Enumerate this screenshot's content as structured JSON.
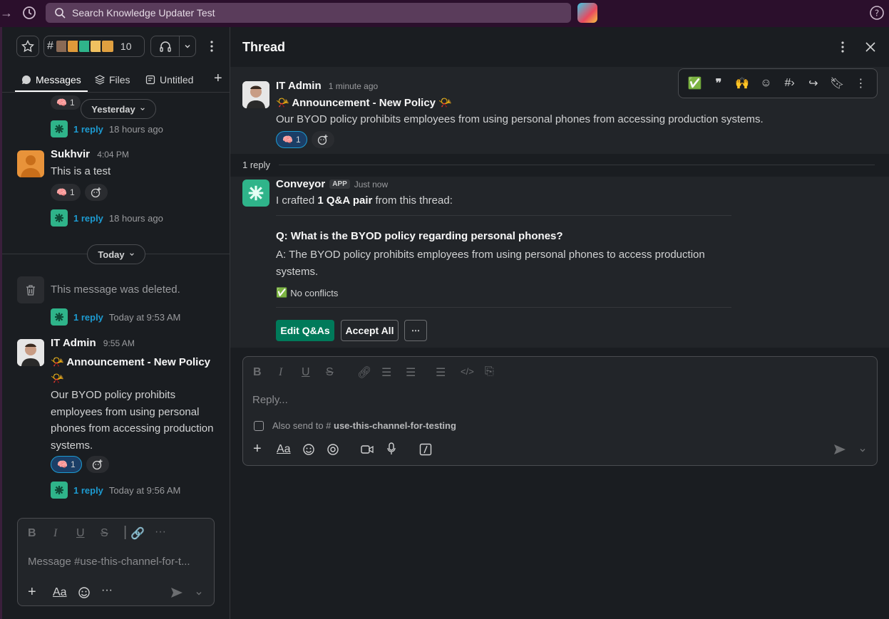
{
  "topbar": {
    "search_placeholder": "Search Knowledge Updater Test"
  },
  "channel_header": {
    "member_count": "10"
  },
  "tabs": [
    {
      "label": "Messages"
    },
    {
      "label": "Files"
    },
    {
      "label": "Untitled"
    }
  ],
  "left_feed": {
    "partial_reaction_count": "1",
    "day1": "Yesterday",
    "reply1": {
      "link": "1 reply",
      "when": "18 hours ago"
    },
    "sukhvir": {
      "name": "Sukhvir",
      "time": "4:04 PM",
      "text": "This is a test",
      "reaction_count": "1"
    },
    "reply2": {
      "link": "1 reply",
      "when": "18 hours ago"
    },
    "day2": "Today",
    "deleted_text": "This message was deleted.",
    "reply3": {
      "link": "1 reply",
      "when": "Today at 9:53 AM"
    },
    "itadmin": {
      "name": "IT Admin",
      "time": "9:55 AM",
      "title": "Announcement - New Policy",
      "body": "Our BYOD policy prohibits employees from using personal phones from accessing production systems.",
      "reaction_count": "1"
    },
    "reply4": {
      "link": "1 reply",
      "when": "Today at 9:56 AM"
    },
    "composer_placeholder": "Message #use-this-channel-for-t..."
  },
  "thread": {
    "title": "Thread",
    "parent": {
      "name": "IT Admin",
      "time": "1 minute ago",
      "title": "Announcement - New Policy",
      "body": "Our BYOD policy prohibits employees from using personal phones from accessing production systems.",
      "reaction_count": "1"
    },
    "reply_count_label": "1 reply",
    "bot": {
      "name": "Conveyor",
      "badge": "APP",
      "time": "Just now",
      "intro_prefix": "I crafted ",
      "intro_bold": "1 Q&A pair",
      "intro_suffix": " from this thread:",
      "question": "Q: What is the BYOD policy regarding personal phones?",
      "answer": "A: The BYOD policy prohibits employees from using personal phones to access production systems.",
      "status": "No conflicts",
      "edit_button": "Edit Q&As",
      "accept_button": "Accept All"
    },
    "reply_placeholder": "Reply...",
    "also_send_prefix": "Also send to",
    "also_send_channel": "use-this-channel-for-testing"
  },
  "colors": {
    "accent_green": "#007a5a",
    "link": "#1d9bd1",
    "topbar": "#2b0f2c"
  }
}
